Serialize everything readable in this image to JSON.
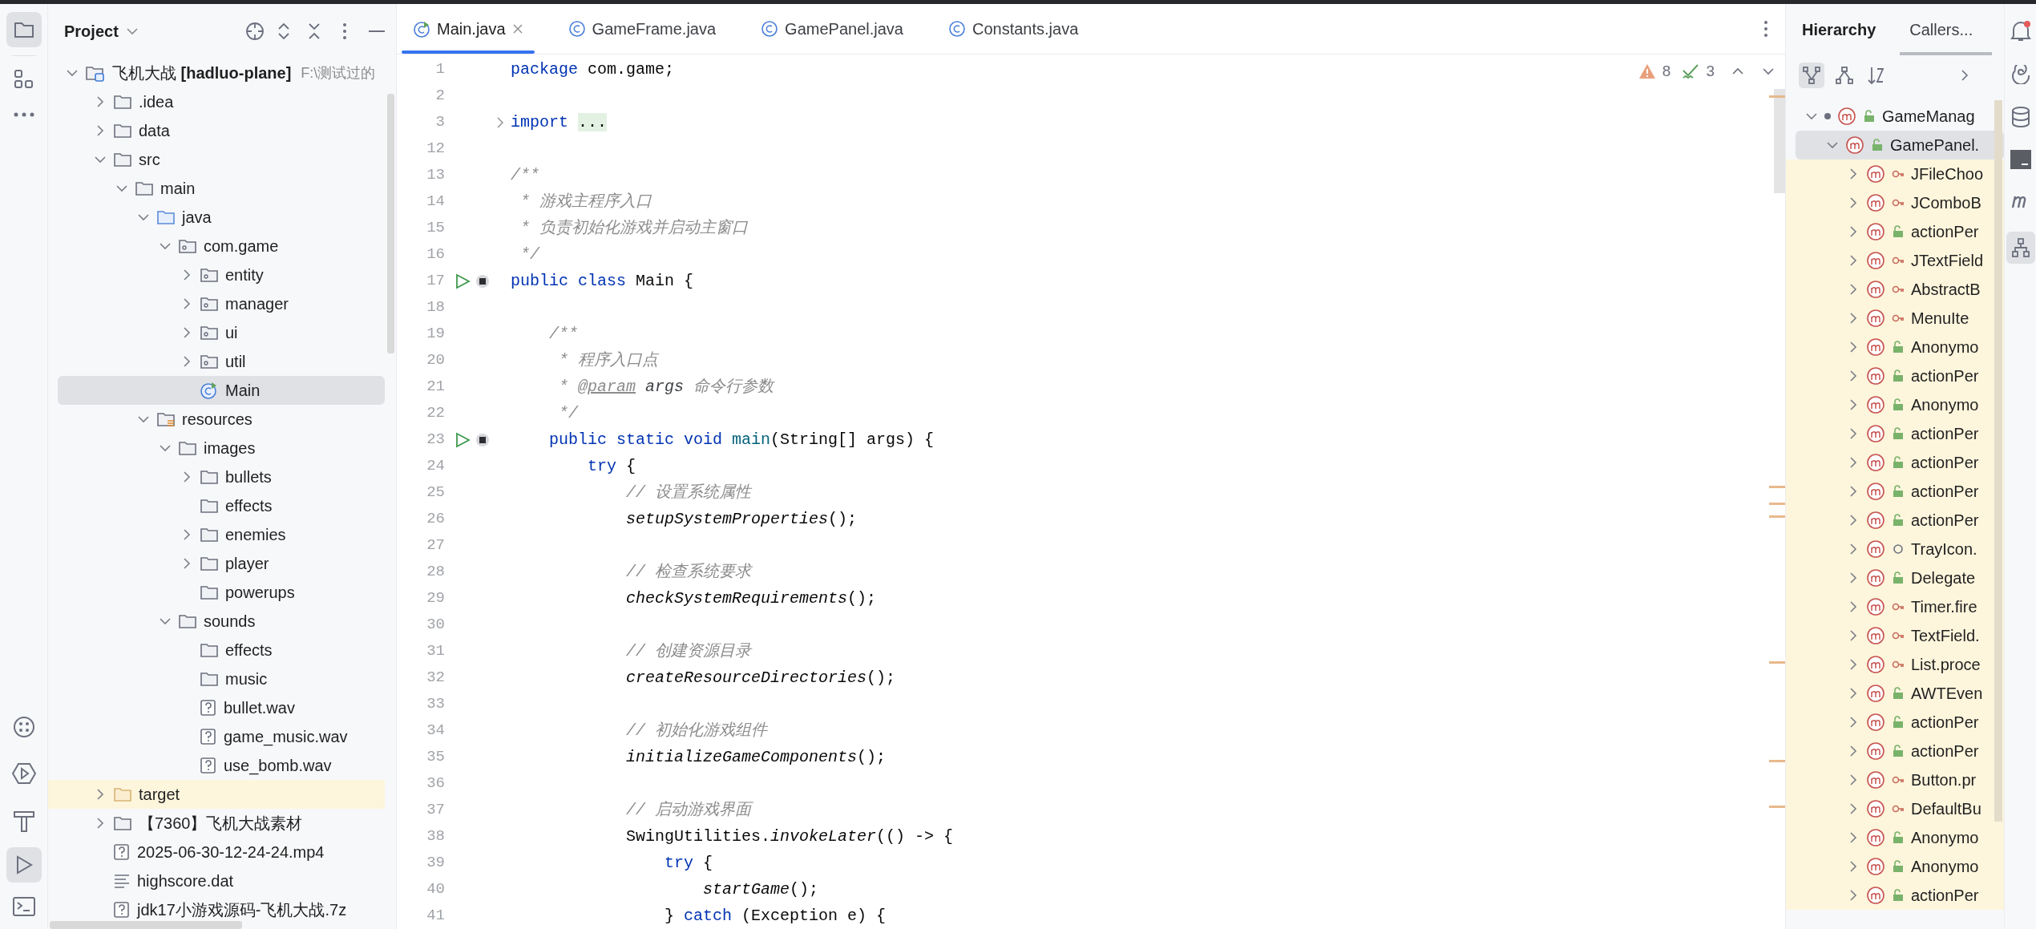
{
  "project_panel": {
    "title": "Project",
    "tree": [
      {
        "label": "飞机大战 **[hadluo-plane]**",
        "path": "F:\\测试过的",
        "kind": "module",
        "expanded": true,
        "selected": false,
        "children": [
          {
            "label": ".idea",
            "kind": "folder",
            "expanded": false,
            "selected": false
          },
          {
            "label": "data",
            "kind": "folder",
            "expanded": false,
            "selected": false
          },
          {
            "label": "src",
            "kind": "folder",
            "expanded": true,
            "selected": false,
            "children": [
              {
                "label": "main",
                "kind": "folder",
                "expanded": true,
                "selected": false,
                "children": [
                  {
                    "label": "java",
                    "kind": "source_folder",
                    "expanded": true,
                    "selected": false,
                    "children": [
                      {
                        "label": "com.game",
                        "kind": "package",
                        "expanded": true,
                        "selected": false,
                        "children": [
                          {
                            "label": "entity",
                            "kind": "package",
                            "expanded": false,
                            "selected": false
                          },
                          {
                            "label": "manager",
                            "kind": "package",
                            "expanded": false,
                            "selected": false
                          },
                          {
                            "label": "ui",
                            "kind": "package",
                            "expanded": false,
                            "selected": false
                          },
                          {
                            "label": "util",
                            "kind": "package",
                            "expanded": false,
                            "selected": false
                          },
                          {
                            "label": "Main",
                            "kind": "class",
                            "selected": true
                          }
                        ]
                      }
                    ]
                  },
                  {
                    "label": "resources",
                    "kind": "resources_folder",
                    "expanded": true,
                    "selected": false,
                    "children": [
                      {
                        "label": "images",
                        "kind": "folder",
                        "expanded": true,
                        "selected": false,
                        "children": [
                          {
                            "label": "bullets",
                            "kind": "folder",
                            "expanded": false,
                            "selected": false
                          },
                          {
                            "label": "effects",
                            "kind": "folder",
                            "selected": false
                          },
                          {
                            "label": "enemies",
                            "kind": "folder",
                            "expanded": false,
                            "selected": false
                          },
                          {
                            "label": "player",
                            "kind": "folder",
                            "expanded": false,
                            "selected": false
                          },
                          {
                            "label": "powerups",
                            "kind": "folder",
                            "selected": false
                          }
                        ]
                      },
                      {
                        "label": "sounds",
                        "kind": "folder",
                        "expanded": true,
                        "selected": false,
                        "children": [
                          {
                            "label": "effects",
                            "kind": "folder",
                            "selected": false
                          },
                          {
                            "label": "music",
                            "kind": "folder",
                            "selected": false
                          },
                          {
                            "label": "bullet.wav",
                            "kind": "unknown_file",
                            "selected": false
                          },
                          {
                            "label": "game_music.wav",
                            "kind": "unknown_file",
                            "selected": false
                          },
                          {
                            "label": "use_bomb.wav",
                            "kind": "unknown_file",
                            "selected": false
                          }
                        ]
                      }
                    ]
                  }
                ]
              }
            ]
          },
          {
            "label": "target",
            "kind": "excluded_folder",
            "expanded": false,
            "selected": false
          },
          {
            "label": "【7360】飞机大战素材",
            "kind": "folder",
            "expanded": false,
            "selected": false
          },
          {
            "label": "2025-06-30-12-24-24.mp4",
            "kind": "unknown_file",
            "selected": false
          },
          {
            "label": "highscore.dat",
            "kind": "text_file",
            "selected": false
          },
          {
            "label": "jdk17小游戏源码-飞机大战.7z",
            "kind": "unknown_file",
            "selected": false
          }
        ]
      }
    ]
  },
  "editor": {
    "tabs": [
      {
        "label": "Main.java",
        "kind": "main_class",
        "selected": true,
        "closable": true
      },
      {
        "label": "GameFrame.java",
        "kind": "class",
        "selected": false,
        "closable": false
      },
      {
        "label": "GamePanel.java",
        "kind": "class",
        "selected": false,
        "closable": false
      },
      {
        "label": "Constants.java",
        "kind": "class",
        "selected": false,
        "closable": false
      }
    ],
    "inspections": {
      "warnings": "8",
      "weak_warnings": "3"
    },
    "lines": [
      {
        "number": "1",
        "tokens": [
          {
            "text": "package",
            "kind": "kw"
          },
          {
            "text": " com.game;",
            "kind": "plain"
          }
        ]
      },
      {
        "number": "2"
      },
      {
        "number": "3",
        "kind": "fold",
        "tokens": [
          {
            "text": "import ",
            "kind": "kw"
          },
          {
            "text": "...",
            "kind": "folded"
          }
        ]
      },
      {
        "number": "12"
      },
      {
        "number": "13",
        "tokens": [
          {
            "text": "/**",
            "kind": "comment"
          }
        ]
      },
      {
        "number": "14",
        "tokens": [
          {
            "text": " * 游戏主程序入口",
            "kind": "comment"
          }
        ]
      },
      {
        "number": "15",
        "tokens": [
          {
            "text": " * 负责初始化游戏并启动主窗口",
            "kind": "comment"
          }
        ]
      },
      {
        "number": "16",
        "tokens": [
          {
            "text": " */",
            "kind": "comment"
          }
        ]
      },
      {
        "number": "17",
        "kind": "run",
        "tokens": [
          {
            "text": "public class",
            "kind": "kw"
          },
          {
            "text": " Main {",
            "kind": "plain"
          }
        ]
      },
      {
        "number": "18"
      },
      {
        "number": "19",
        "tokens": [
          {
            "text": "    /**",
            "kind": "comment"
          }
        ]
      },
      {
        "number": "20",
        "tokens": [
          {
            "text": "     * 程序入口点",
            "kind": "comment"
          }
        ]
      },
      {
        "number": "21",
        "tokens": [
          {
            "text": "     * ",
            "kind": "comment"
          },
          {
            "text": "@param",
            "kind": "tag"
          },
          {
            "text": " args",
            "kind": "docparam"
          },
          {
            "text": " 命令行参数",
            "kind": "comment"
          }
        ]
      },
      {
        "number": "22",
        "tokens": [
          {
            "text": "     */",
            "kind": "comment"
          }
        ]
      },
      {
        "number": "23",
        "kind": "run",
        "tokens": [
          {
            "text": "    public static void ",
            "kind": "kw"
          },
          {
            "text": "main",
            "kind": "fn"
          },
          {
            "text": "(String[] args) {",
            "kind": "plain"
          }
        ]
      },
      {
        "number": "24",
        "tokens": [
          {
            "text": "        try",
            "kind": "kw"
          },
          {
            "text": " {",
            "kind": "plain"
          }
        ]
      },
      {
        "number": "25",
        "tokens": [
          {
            "text": "            // 设置系统属性",
            "kind": "comment"
          }
        ]
      },
      {
        "number": "26",
        "tokens": [
          {
            "text": "            setupSystemProperties",
            "kind": "call"
          },
          {
            "text": "();",
            "kind": "plain"
          }
        ]
      },
      {
        "number": "27"
      },
      {
        "number": "28",
        "tokens": [
          {
            "text": "            // 检查系统要求",
            "kind": "comment"
          }
        ]
      },
      {
        "number": "29",
        "tokens": [
          {
            "text": "            checkSystemRequirements",
            "kind": "call"
          },
          {
            "text": "();",
            "kind": "plain"
          }
        ]
      },
      {
        "number": "30"
      },
      {
        "number": "31",
        "tokens": [
          {
            "text": "            // 创建资源目录",
            "kind": "comment"
          }
        ]
      },
      {
        "number": "32",
        "tokens": [
          {
            "text": "            createResourceDirectories",
            "kind": "call"
          },
          {
            "text": "();",
            "kind": "plain"
          }
        ]
      },
      {
        "number": "33"
      },
      {
        "number": "34",
        "tokens": [
          {
            "text": "            // 初始化游戏组件",
            "kind": "comment"
          }
        ]
      },
      {
        "number": "35",
        "tokens": [
          {
            "text": "            initializeGameComponents",
            "kind": "call"
          },
          {
            "text": "();",
            "kind": "plain"
          }
        ]
      },
      {
        "number": "36"
      },
      {
        "number": "37",
        "tokens": [
          {
            "text": "            // 启动游戏界面",
            "kind": "comment"
          }
        ]
      },
      {
        "number": "38",
        "tokens": [
          {
            "text": "            SwingUtilities.",
            "kind": "plain"
          },
          {
            "text": "invokeLater",
            "kind": "call"
          },
          {
            "text": "(() -> {",
            "kind": "plain"
          }
        ]
      },
      {
        "number": "39",
        "tokens": [
          {
            "text": "                try",
            "kind": "kw"
          },
          {
            "text": " {",
            "kind": "plain"
          }
        ]
      },
      {
        "number": "40",
        "tokens": [
          {
            "text": "                    startGame",
            "kind": "call"
          },
          {
            "text": "();",
            "kind": "plain"
          }
        ]
      },
      {
        "number": "41",
        "tokens": [
          {
            "text": "                } ",
            "kind": "plain"
          },
          {
            "text": "catch",
            "kind": "kw"
          },
          {
            "text": " (Exception e) {",
            "kind": "plain"
          }
        ]
      }
    ]
  },
  "hierarchy_panel": {
    "title": "Hierarchy",
    "tabs": [
      {
        "label": "Callers...",
        "selected": true
      }
    ],
    "tree": [
      {
        "label": "GameManag",
        "kind": "public",
        "expanded": true,
        "selected": false,
        "children": [
          {
            "label": "GamePanel.",
            "kind": "public",
            "expanded": true,
            "selected": true,
            "children": [
              {
                "label": "JFileChoo",
                "kind": "protected",
                "expanded": false,
                "selected": false
              },
              {
                "label": "JComboB",
                "kind": "protected",
                "expanded": false,
                "selected": false
              },
              {
                "label": "actionPer",
                "kind": "public",
                "expanded": false,
                "selected": false
              },
              {
                "label": "JTextField",
                "kind": "protected",
                "expanded": false,
                "selected": false
              },
              {
                "label": "AbstractB",
                "kind": "protected",
                "expanded": false,
                "selected": false
              },
              {
                "label": "MenuIte",
                "kind": "protected",
                "expanded": false,
                "selected": false
              },
              {
                "label": "Anonymo",
                "kind": "public",
                "expanded": false,
                "selected": false
              },
              {
                "label": "actionPer",
                "kind": "public",
                "expanded": false,
                "selected": false
              },
              {
                "label": "Anonymo",
                "kind": "public",
                "expanded": false,
                "selected": false
              },
              {
                "label": "actionPer",
                "kind": "public",
                "expanded": false,
                "selected": false
              },
              {
                "label": "actionPer",
                "kind": "public",
                "expanded": false,
                "selected": false
              },
              {
                "label": "actionPer",
                "kind": "public",
                "expanded": false,
                "selected": false
              },
              {
                "label": "actionPer",
                "kind": "public",
                "expanded": false,
                "selected": false
              },
              {
                "label": "TrayIcon.",
                "kind": "package",
                "expanded": false,
                "selected": false
              },
              {
                "label": "Delegate",
                "kind": "public",
                "expanded": false,
                "selected": false
              },
              {
                "label": "Timer.fire",
                "kind": "protected",
                "expanded": false,
                "selected": false
              },
              {
                "label": "TextField.",
                "kind": "protected",
                "expanded": false,
                "selected": false
              },
              {
                "label": "List.proce",
                "kind": "protected",
                "expanded": false,
                "selected": false
              },
              {
                "label": "AWTEven",
                "kind": "public",
                "expanded": false,
                "selected": false
              },
              {
                "label": "actionPer",
                "kind": "public",
                "expanded": false,
                "selected": false
              },
              {
                "label": "actionPer",
                "kind": "public",
                "expanded": false,
                "selected": false
              },
              {
                "label": "Button.pr",
                "kind": "protected",
                "expanded": false,
                "selected": false
              },
              {
                "label": "DefaultBu",
                "kind": "protected",
                "expanded": false,
                "selected": false
              },
              {
                "label": "Anonymo",
                "kind": "public",
                "expanded": false,
                "selected": false
              },
              {
                "label": "Anonymo",
                "kind": "public",
                "expanded": false,
                "selected": false
              },
              {
                "label": "actionPer",
                "kind": "public",
                "expanded": false,
                "selected": false
              }
            ]
          }
        ]
      }
    ]
  }
}
